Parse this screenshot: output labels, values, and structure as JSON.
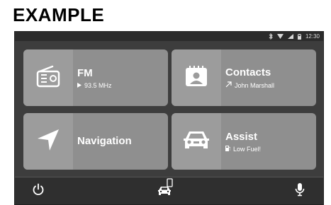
{
  "heading": "EXAMPLE",
  "status": {
    "time": "12:30",
    "icons": [
      "bluetooth-icon",
      "wifi-icon",
      "signal-icon",
      "battery-icon"
    ]
  },
  "tiles": {
    "fm": {
      "title": "FM",
      "subtitle": "93.5 MHz",
      "icon": "radio-icon"
    },
    "contacts": {
      "title": "Contacts",
      "subtitle": "John Marshall",
      "icon": "contact-card-icon"
    },
    "navigation": {
      "title": "Navigation",
      "icon": "navigation-arrow-icon"
    },
    "assist": {
      "title": "Assist",
      "subtitle": "Low Fuel!",
      "icon": "car-front-icon"
    }
  },
  "bottom_bar": {
    "buttons": [
      "power-icon",
      "phone-car-icon",
      "microphone-icon"
    ]
  },
  "colors": {
    "frame": "#3d3d3d",
    "tile": "#8f8f8f",
    "tile_icon_panel": "#9c9c9c",
    "bottom_bar": "#2f2f2f"
  }
}
